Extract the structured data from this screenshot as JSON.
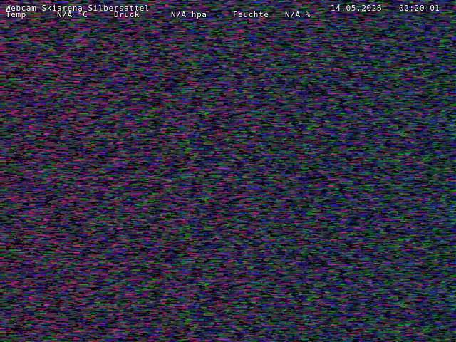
{
  "overlay": {
    "title": "Webcam Skiarena Silbersattel",
    "date": "14.05.2026",
    "time": "02:20:01",
    "temp_label": "Temp",
    "temp_value": "N/A °C",
    "pressure_label": "Druck",
    "pressure_value": "N/A hpa",
    "humidity_label": "Feuchte",
    "humidity_value": "N/A %"
  },
  "image": {
    "description_colors": {
      "magenta": "#c0307a",
      "blue": "#2a2ad0",
      "red": "#c02828",
      "green": "#2a9a3a",
      "dark": "#0a0410"
    }
  }
}
